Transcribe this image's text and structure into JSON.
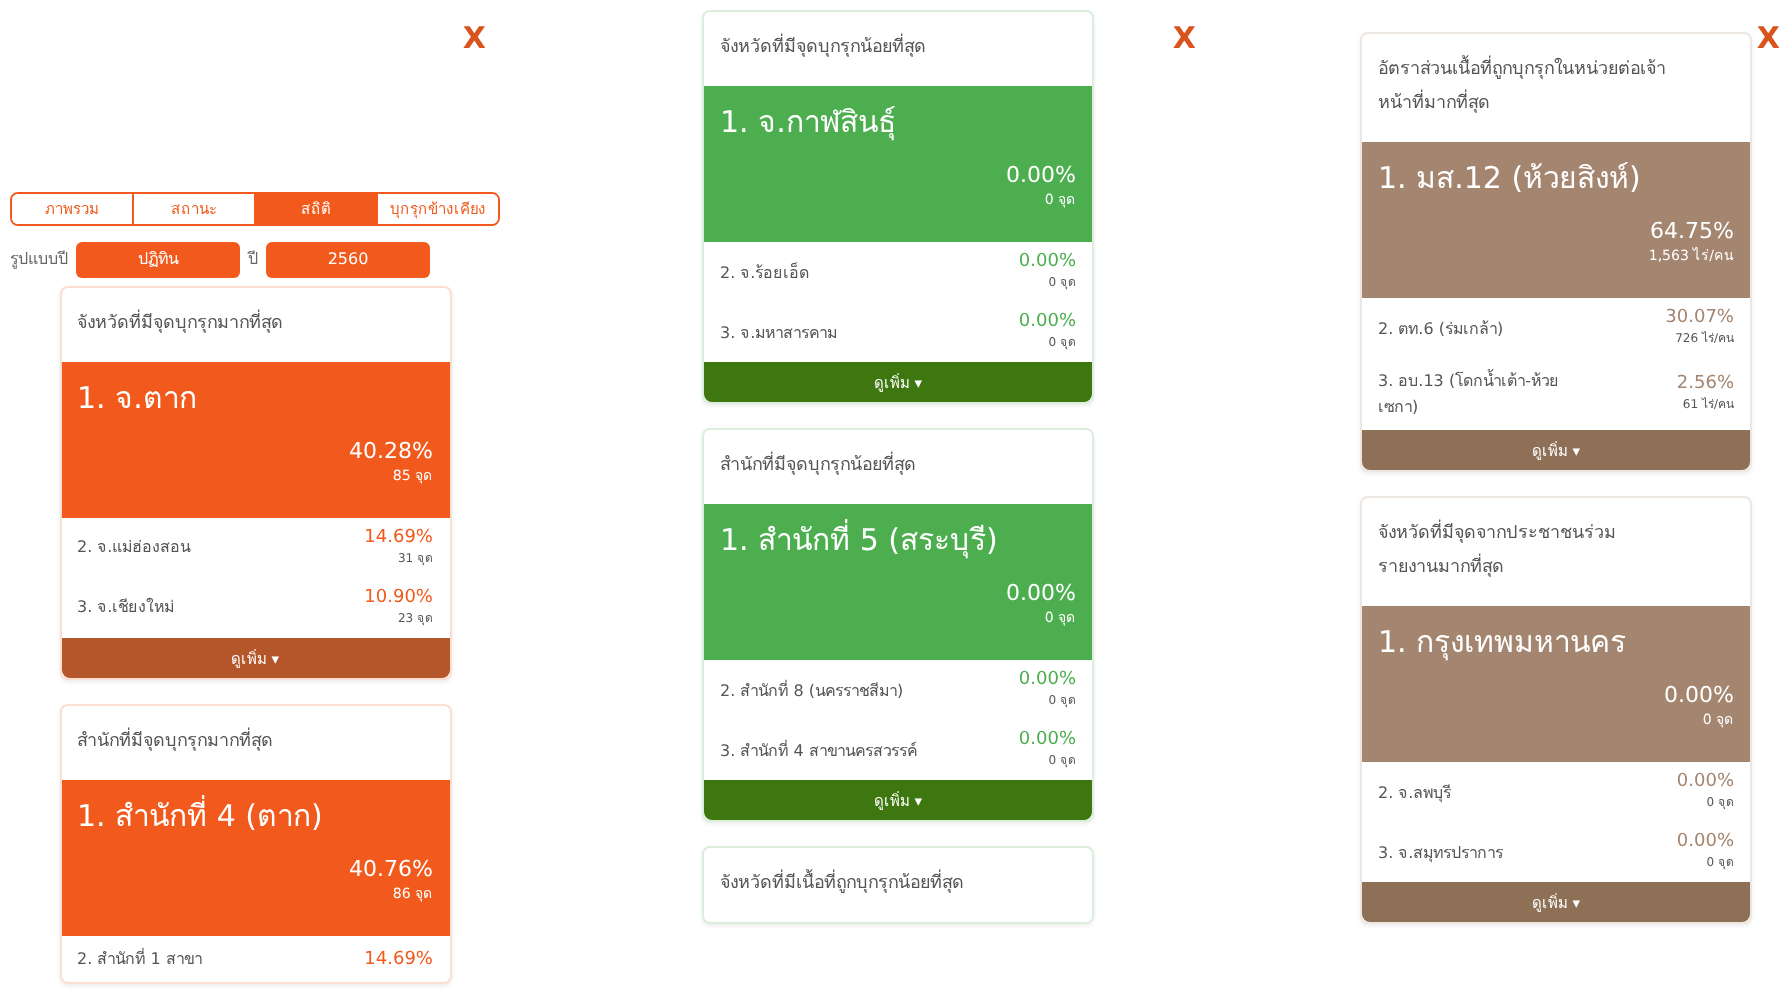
{
  "panels": [
    {
      "close": "X",
      "tabs": [
        {
          "label": "ภาพรวม",
          "selected": false
        },
        {
          "label": "สถานะ",
          "selected": false
        },
        {
          "label": "สถิติ",
          "selected": true
        },
        {
          "label": "บุกรุกข้างเคียง",
          "selected": false
        }
      ],
      "filter": {
        "label": "รูปแบบปี",
        "type_value": "ปฏิทิน",
        "separator": "ปี",
        "year_value": "2560"
      },
      "cards": [
        {
          "kind": "high",
          "title": "จังหวัดที่มีจุดบุกรุกมากที่สุด",
          "top": {
            "name": "1. จ.ตาก",
            "percent": "40.28%",
            "count": "85 จุด"
          },
          "rows": [
            {
              "name": "2. จ.แม่ฮ่องสอน",
              "percent": "14.69%",
              "count": "31 จุด"
            },
            {
              "name": "3. จ.เชียงใหม่",
              "percent": "10.90%",
              "count": "23 จุด"
            }
          ],
          "more": "ดูเพิ่ม ▾"
        },
        {
          "kind": "high",
          "title": "สำนักที่มีจุดบุกรุกมากที่สุด",
          "top": {
            "name": "1. สำนักที่ 4 (ตาก)",
            "percent": "40.76%",
            "count": "86 จุด"
          },
          "rows": [
            {
              "name": "2. สำนักที่ 1 สาขา",
              "percent": "14.69%"
            }
          ]
        }
      ]
    },
    {
      "close": "X",
      "cards": [
        {
          "kind": "low",
          "title": "จังหวัดที่มีจุดบุกรุกน้อยที่สุด",
          "top": {
            "name": "1. จ.กาฬสินธุ์",
            "percent": "0.00%",
            "count": "0 จุด"
          },
          "rows": [
            {
              "name": "2. จ.ร้อยเอ็ด",
              "percent": "0.00%",
              "count": "0 จุด"
            },
            {
              "name": "3. จ.มหาสารคาม",
              "percent": "0.00%",
              "count": "0 จุด"
            }
          ],
          "more": "ดูเพิ่ม ▾"
        },
        {
          "kind": "low",
          "title": "สำนักที่มีจุดบุกรุกน้อยที่สุด",
          "top": {
            "name": "1. สำนักที่ 5 (สระบุรี)",
            "percent": "0.00%",
            "count": "0 จุด"
          },
          "rows": [
            {
              "name": "2. สำนักที่ 8 (นครราชสีมา)",
              "percent": "0.00%",
              "count": "0 จุด"
            },
            {
              "name": "3. สำนักที่ 4 สาขานครสวรรค์",
              "percent": "0.00%",
              "count": "0 จุด"
            }
          ],
          "more": "ดูเพิ่ม ▾"
        },
        {
          "kind": "low",
          "title": "จังหวัดที่มีเนื้อที่ถูกบุกรุกน้อยที่สุด"
        }
      ]
    },
    {
      "close": "X",
      "cards": [
        {
          "kind": "ratio",
          "title": "อัตราส่วนเนื้อที่ถูกบุกรุกในหน่วยต่อเจ้าหน้าที่มากที่สุด",
          "top": {
            "name": "1. มส.12 (ห้วยสิงห์)",
            "percent": "64.75%",
            "count": "1,563 ไร่/คน"
          },
          "rows": [
            {
              "name": "2. ตท.6 (ร่มเกล้า)",
              "percent": "30.07%",
              "count": "726 ไร่/คน"
            },
            {
              "name": "3. อบ.13 (โดกน้ำเต้า-ห้วยเซกา)",
              "percent": "2.56%",
              "count": "61 ไร่/คน"
            }
          ],
          "more": "ดูเพิ่ม ▾"
        },
        {
          "kind": "ratio",
          "title": "จังหวัดที่มีจุดจากประชาชนร่วมรายงานมากที่สุด",
          "top": {
            "name": "1. กรุงเทพมหานคร",
            "percent": "0.00%",
            "count": "0 จุด"
          },
          "rows": [
            {
              "name": "2. จ.ลพบุรี",
              "percent": "0.00%",
              "count": "0 จุด"
            },
            {
              "name": "3. จ.สมุทรปราการ",
              "percent": "0.00%",
              "count": "0 จุด"
            }
          ],
          "more": "ดูเพิ่ม ▾"
        }
      ]
    }
  ]
}
